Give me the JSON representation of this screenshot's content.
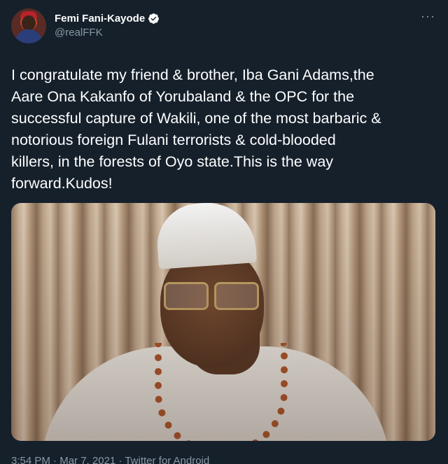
{
  "author": {
    "display_name": "Femi Fani-Kayode",
    "handle": "@realFFK",
    "verified": true
  },
  "tweet": {
    "text_lines": [
      "I congratulate my friend & brother, Iba Gani Adams,the",
      "Aare Ona Kakanfo of Yorubaland & the OPC for the",
      "successful capture of Wakili, one of the most barbaric &",
      "notorious foreign Fulani terrorists & cold-blooded",
      "killers, in the forests of Oyo state.This is the way",
      "forward.Kudos!"
    ],
    "time": "3:54 PM",
    "separator": "·",
    "date": "Mar 7, 2021",
    "source": "Twitter for Android"
  },
  "icons": {
    "more": "more-options-icon",
    "verified": "verified-badge-icon"
  },
  "colors": {
    "background": "#15202b",
    "secondary_text": "#8899a6",
    "verified_badge": "#ffffff"
  }
}
